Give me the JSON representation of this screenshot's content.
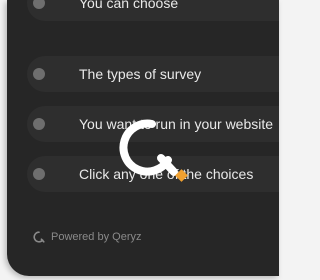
{
  "survey": {
    "options": [
      {
        "label": "You can choose"
      },
      {
        "label": "The types of survey"
      },
      {
        "label": "You want to run in your website"
      },
      {
        "label": "Click any one of the choices"
      }
    ]
  },
  "footer": {
    "powered_by": "Powered by Qeryz",
    "icon": "qeryz-logo-icon"
  },
  "loader": {
    "icon": "qeryz-loading-spinner-icon",
    "accent_color": "#f0a030",
    "ring_color": "#ffffff"
  },
  "colors": {
    "panel_background": "#262626",
    "option_background": "#2e2e2e",
    "radio": "#6e6e6e",
    "option_text": "#e9e9e9",
    "footer_text": "#8a8a8a"
  }
}
